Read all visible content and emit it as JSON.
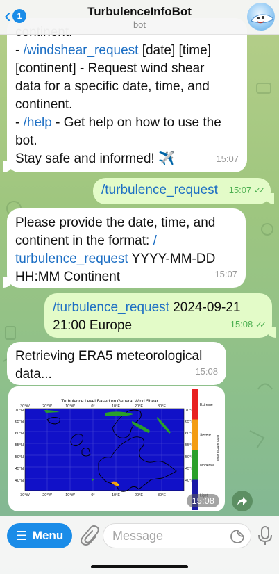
{
  "header": {
    "back_badge": "1",
    "title": "TurbulenceInfoBot",
    "subtitle": "bot"
  },
  "messages": [
    {
      "cutoff_line": "continent.",
      "line1_cmd": "/windshear_request",
      "line1_rest": " [date] [time]",
      "line2": "[continent] - Request wind shear",
      "line3": "data for a specific date, time, and",
      "line4": "continent.",
      "line5_prefix": "- ",
      "line5_cmd": "/help",
      "line5_rest": " - Get help on how to use the",
      "line6": "bot.",
      "line7": "Stay safe and informed! ✈️",
      "time": "15:07"
    },
    {
      "text": "/turbulence_request",
      "time": "15:07"
    },
    {
      "line1": "Please provide the date, time, and",
      "line2a": "continent in the format: ",
      "line2b": "/",
      "line3a": "turbulence_request",
      "line3b": " YYYY-MM-DD",
      "line4": "HH:MM Continent",
      "time": "15:07"
    },
    {
      "cmd": "/turbulence_request",
      "rest": " 2024-09-21",
      "line2": "21:00 Europe",
      "time": "15:08"
    },
    {
      "line1": "Retrieving ERA5 meteorological",
      "line2": "data...",
      "time": "15:08"
    }
  ],
  "chart_data": {
    "type": "heatmap",
    "title": "Turbulence Level Based on General Wind Shear",
    "x_ticks": [
      "30°W",
      "20°W",
      "10°W",
      "0°",
      "10°E",
      "20°E",
      "30°E"
    ],
    "y_ticks": [
      "70°N",
      "65°N",
      "60°N",
      "55°N",
      "50°N",
      "45°N",
      "40°N"
    ],
    "colorbar_label": "Turbulence Level",
    "levels": [
      "Light",
      "Moderate",
      "Severe",
      "Extreme"
    ],
    "level_colors": [
      "#1a1aa8",
      "#2aa02a",
      "#f39c12",
      "#e82020"
    ],
    "time": "15:08"
  },
  "input": {
    "menu_label": "Menu",
    "placeholder": "Message"
  }
}
